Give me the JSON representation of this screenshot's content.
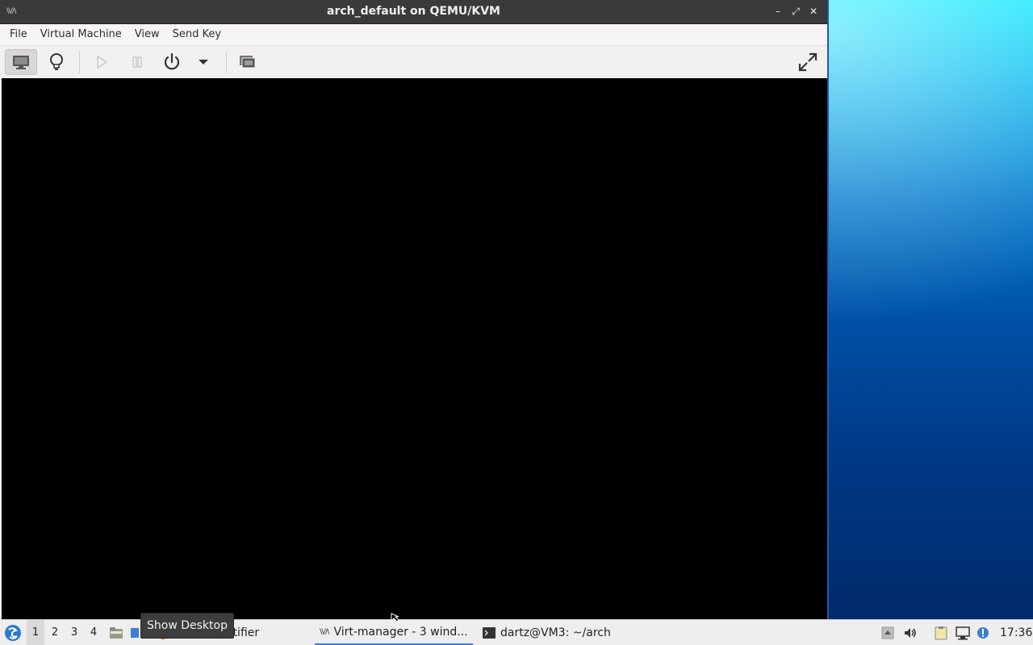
{
  "window": {
    "title": "arch_default on QEMU/KVM",
    "app_icon_text": "\\\\//\\",
    "buttons": {
      "minimize": "–",
      "maximize": "⤢",
      "close": "✕"
    }
  },
  "menubar": {
    "items": [
      "File",
      "Virtual Machine",
      "View",
      "Send Key"
    ]
  },
  "toolbar": {
    "buttons": [
      {
        "name": "console",
        "icon": "monitor-icon",
        "active": true
      },
      {
        "name": "details",
        "icon": "lightbulb-icon"
      },
      {
        "name": "run",
        "icon": "play-icon",
        "disabled": true
      },
      {
        "name": "pause",
        "icon": "pause-icon",
        "disabled": true
      },
      {
        "name": "shutdown",
        "icon": "power-icon"
      },
      {
        "name": "shutdown-menu",
        "icon": "chevron-down-icon"
      },
      {
        "name": "snapshots",
        "icon": "snapshots-icon"
      },
      {
        "name": "fullscreen",
        "icon": "fullscreen-icon"
      }
    ]
  },
  "taskbar": {
    "workspaces": [
      "1",
      "2",
      "3",
      "4"
    ],
    "active_workspace": "1",
    "partial_task_label": "otifier",
    "tasks": [
      {
        "label": "Virt-manager - 3 wind...",
        "active": true,
        "icon": "virt-manager-icon"
      },
      {
        "label": "dartz@VM3: ~/arch",
        "active": false,
        "icon": "terminal-icon"
      }
    ],
    "clock": "17:36"
  },
  "tooltip": {
    "text": "Show Desktop"
  },
  "colors": {
    "titlebar": "#3a3a3a",
    "accent": "#3b7fd4",
    "display": "#000000"
  }
}
